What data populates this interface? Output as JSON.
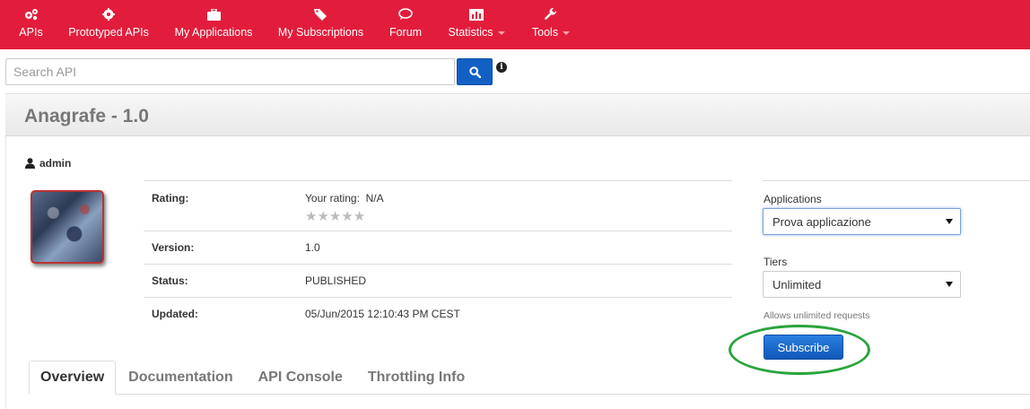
{
  "nav": {
    "items": [
      {
        "label": "APIs",
        "icon": "gears-icon"
      },
      {
        "label": "Prototyped APIs",
        "icon": "gear-icon"
      },
      {
        "label": "My Applications",
        "icon": "briefcase-icon"
      },
      {
        "label": "My Subscriptions",
        "icon": "tags-icon"
      },
      {
        "label": "Forum",
        "icon": "speech-bubble-icon"
      },
      {
        "label": "Statistics",
        "icon": "chart-icon",
        "dropdown": true
      },
      {
        "label": "Tools",
        "icon": "wrench-icon",
        "dropdown": true
      }
    ]
  },
  "search": {
    "placeholder": "Search API",
    "value": ""
  },
  "api": {
    "title": "Anagrafe - 1.0",
    "owner": "admin",
    "details": {
      "rating_label": "Rating:",
      "your_rating": "Your rating:  N/A",
      "stars": 5,
      "version_label": "Version:",
      "version": "1.0",
      "status_label": "Status:",
      "status": "PUBLISHED",
      "updated_label": "Updated:",
      "updated": "05/Jun/2015 12:10:43 PM CEST"
    }
  },
  "subscribe_panel": {
    "applications_label": "Applications",
    "application_selected": "Prova applicazione",
    "tiers_label": "Tiers",
    "tier_selected": "Unlimited",
    "tier_hint": "Allows unlimited requests",
    "subscribe_label": "Subscribe"
  },
  "tabs": [
    {
      "label": "Overview",
      "active": true
    },
    {
      "label": "Documentation",
      "active": false
    },
    {
      "label": "API Console",
      "active": false
    },
    {
      "label": "Throttling Info",
      "active": false
    }
  ],
  "colors": {
    "nav_bg": "#e21d3c",
    "primary_button": "#1260c4",
    "highlight_ring": "#2aa43c"
  }
}
